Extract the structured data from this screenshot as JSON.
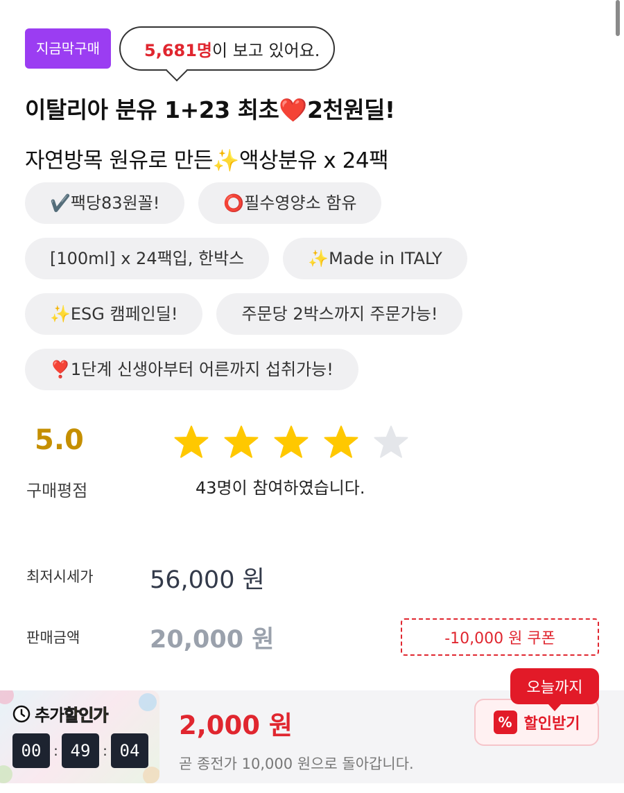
{
  "header": {
    "badge": "지금막구매",
    "viewer_count": "5,681명",
    "viewer_suffix": "이 보고 있어요."
  },
  "product": {
    "title": "이탈리아 분유 1+23 최초❤️2천원딜!",
    "subtitle": "자연방목 원유로 만든✨액상분유 x 24팩"
  },
  "tags": [
    "✔️팩당83원꼴!",
    "⭕필수영양소 함유",
    "[100ml] x 24팩입, 한박스",
    "✨Made in ITALY",
    "✨ESG 캠페인딜!",
    "주문당 2박스까지 주문가능!",
    "❣️1단계 신생아부터 어른까지 섭취가능!"
  ],
  "rating": {
    "score": "5.0",
    "label": "구매평점",
    "stars_filled": 4,
    "stars_total": 5,
    "participants": "43명이 참여하였습니다."
  },
  "prices": {
    "lowest_label": "최저시세가",
    "lowest_value": "56,000 원",
    "sale_label": "판매금액",
    "sale_value": "20,000 원",
    "coupon": "-10,000 원 쿠폰"
  },
  "deal": {
    "timer_title_plain": "추가",
    "timer_title_highlight": "할인가",
    "hours": "00",
    "minutes": "49",
    "seconds": "04",
    "price": "2,000 원",
    "note": "곧 종전가 10,000 원으로 돌아갑니다.",
    "today_label": "오늘까지",
    "discount_button": "할인받기",
    "percent_symbol": "%"
  },
  "colors": {
    "accent_red": "#e0262f",
    "badge_purple": "#9b3df2",
    "star_gold": "#ffc800",
    "star_empty": "#e4e6ea",
    "score_gold": "#c58f00"
  },
  "icons": {
    "clock": "clock-icon",
    "star": "star-icon",
    "percent": "percent-icon"
  }
}
